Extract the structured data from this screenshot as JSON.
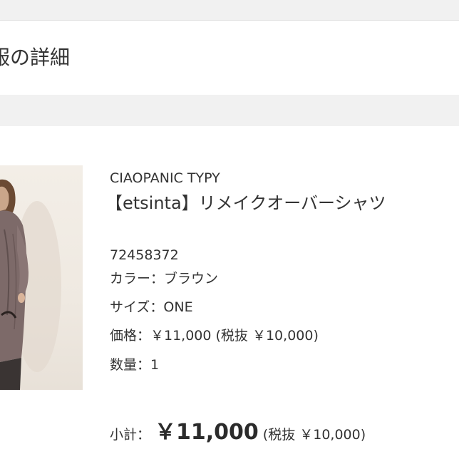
{
  "header": {
    "title": "服の詳細"
  },
  "product": {
    "brand": "CIAOPANIC TYPY",
    "name": "【etsinta】リメイクオーバーシャツ",
    "item_number": "72458372",
    "color_line": "カラー：ブラウン",
    "size_line": "サイズ：ONE",
    "price_line": "価格：￥11,000 (税抜 ￥10,000)",
    "quantity_line": "数量：1",
    "image_icon": "product-photo"
  },
  "subtotal": {
    "label": "小計：",
    "amount": "￥11,000",
    "tax_note": "(税抜 ￥10,000)"
  },
  "colors": {
    "page_background": "#f1f1f1",
    "card_background": "#ffffff",
    "text": "#333333"
  }
}
